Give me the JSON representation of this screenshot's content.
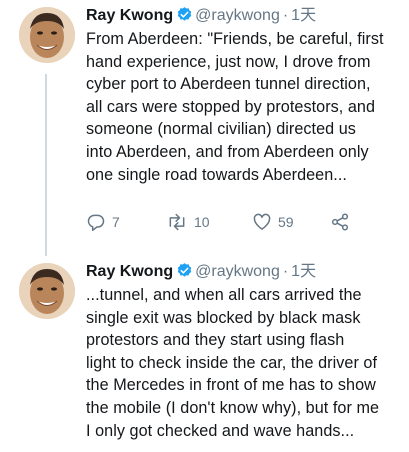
{
  "tweets": [
    {
      "author_name": "Ray Kwong",
      "handle": "@raykwong",
      "separator": "·",
      "time": "1天",
      "text": "From Aberdeen: \"Friends, be careful, first\nhand experience, just now, I drove from\ncyber port to Aberdeen tunnel direction,\nall cars were stopped by protestors, and\nsomeone (normal civilian) directed us\ninto Aberdeen, and from Aberdeen only\none single road towards Aberdeen...",
      "reply_count": "7",
      "retweet_count": "10",
      "like_count": "59"
    },
    {
      "author_name": "Ray Kwong",
      "handle": "@raykwong",
      "separator": "·",
      "time": "1天",
      "text": "...tunnel, and when all cars arrived the\nsingle exit was blocked by black mask\nprotestors and they start using flash\nlight to check inside the car, the driver of\nthe Mercedes in front of me has to show\nthe mobile (I don't know why), but for me\nI only got checked and wave hands..."
    }
  ],
  "icons": {
    "verified": "verified-badge-icon",
    "reply": "reply-icon",
    "retweet": "retweet-icon",
    "like": "heart-icon",
    "share": "share-icon"
  },
  "colors": {
    "verified": "#1da1f2",
    "secondary_text": "#657786",
    "thread_line": "#cfd9de"
  }
}
